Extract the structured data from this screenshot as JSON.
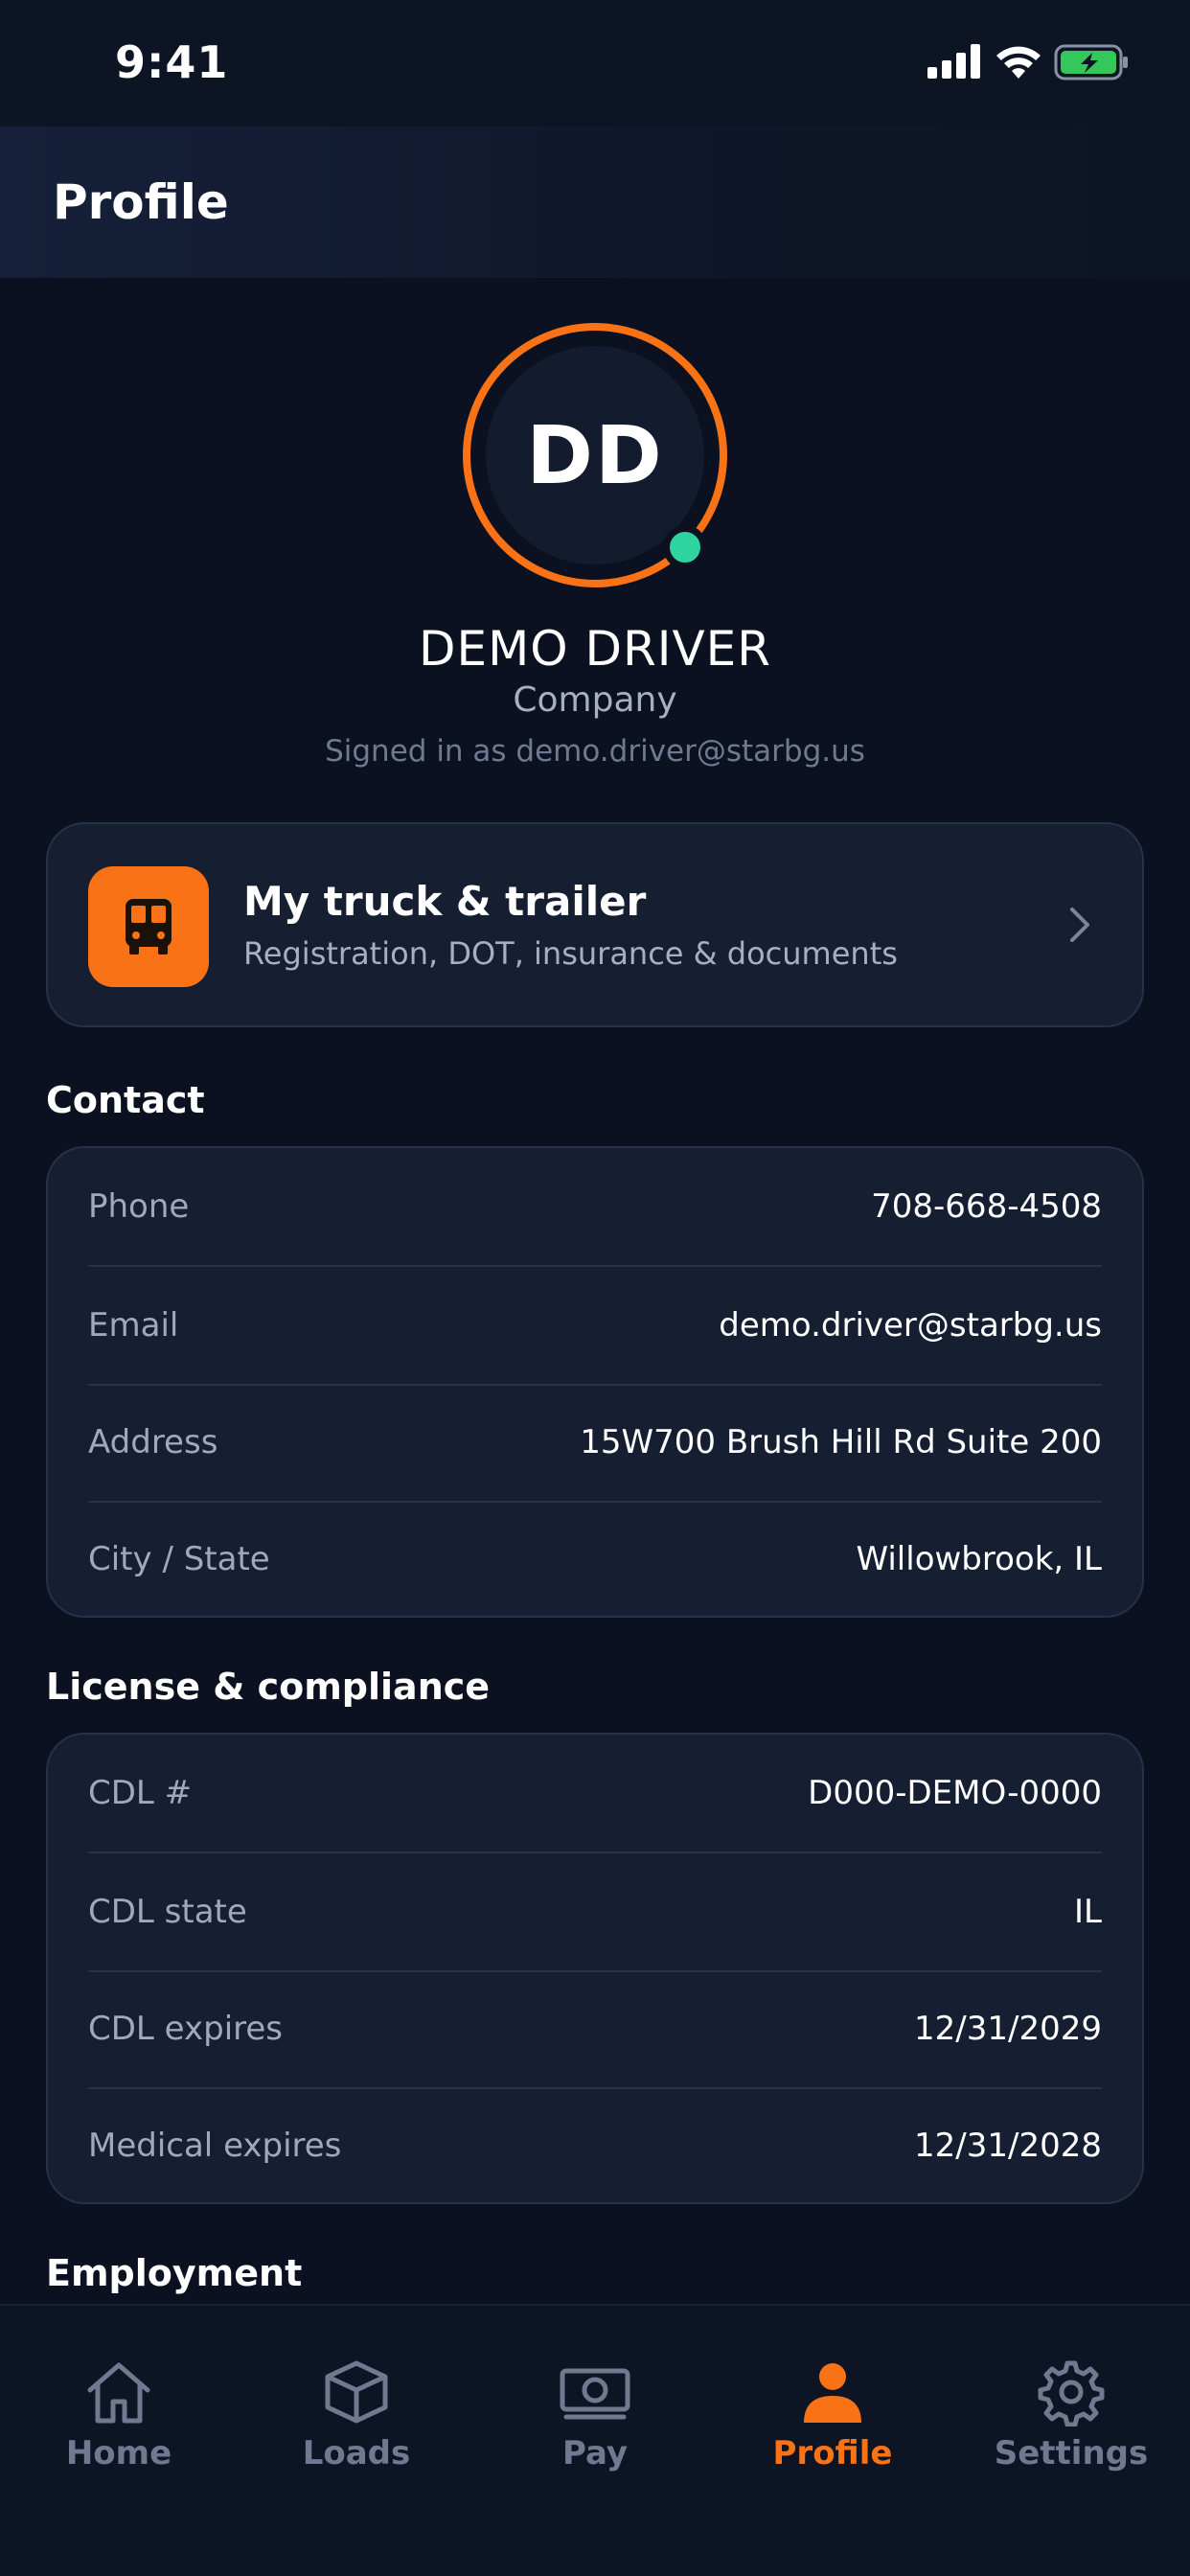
{
  "status_bar": {
    "time": "9:41"
  },
  "header": {
    "title": "Profile"
  },
  "profile": {
    "initials": "DD",
    "name": "DEMO DRIVER",
    "role": "Company",
    "signed_in": "Signed in as demo.driver@starbg.us",
    "online": true
  },
  "truck_card": {
    "title": "My truck & trailer",
    "subtitle": "Registration, DOT, insurance & documents"
  },
  "contact": {
    "title": "Contact",
    "rows": [
      {
        "label": "Phone",
        "value": "708-668-4508"
      },
      {
        "label": "Email",
        "value": "demo.driver@starbg.us"
      },
      {
        "label": "Address",
        "value": "15W700 Brush Hill Rd Suite 200"
      },
      {
        "label": "City / State",
        "value": "Willowbrook, IL"
      }
    ]
  },
  "license": {
    "title": "License & compliance",
    "rows": [
      {
        "label": "CDL #",
        "value": "D000-DEMO-0000"
      },
      {
        "label": "CDL state",
        "value": "IL"
      },
      {
        "label": "CDL expires",
        "value": "12/31/2029"
      },
      {
        "label": "Medical expires",
        "value": "12/31/2028"
      }
    ]
  },
  "employment": {
    "title": "Employment"
  },
  "nav": {
    "items": [
      {
        "label": "Home",
        "icon": "home-icon"
      },
      {
        "label": "Loads",
        "icon": "box-icon"
      },
      {
        "label": "Pay",
        "icon": "cash-icon"
      },
      {
        "label": "Profile",
        "icon": "person-icon"
      },
      {
        "label": "Settings",
        "icon": "gear-icon"
      }
    ],
    "active": "Profile"
  },
  "colors": {
    "accent": "#f97316",
    "online": "#2dd4a0",
    "background": "#0b1120",
    "card": "#161e31"
  }
}
